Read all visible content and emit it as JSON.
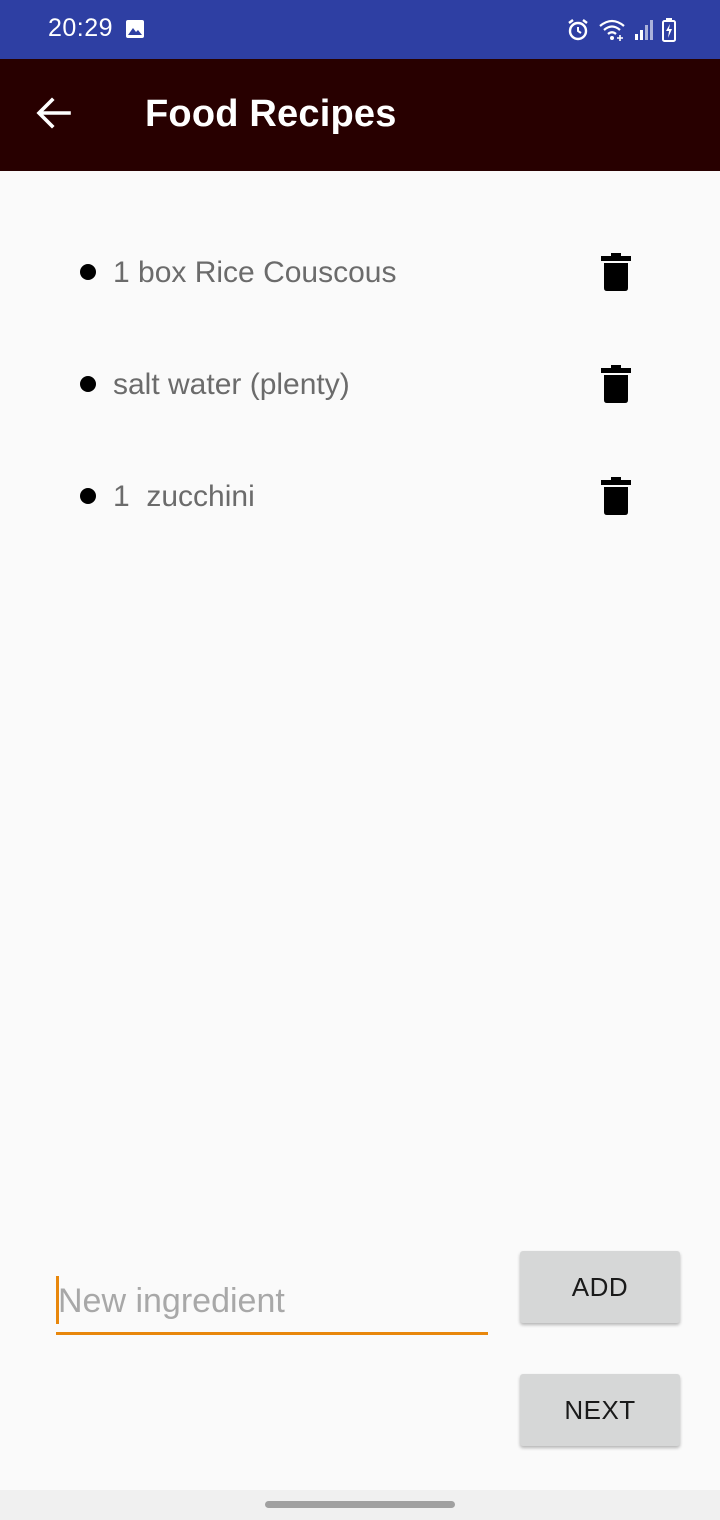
{
  "status_bar": {
    "time": "20:29",
    "icons": [
      "image-icon",
      "alarm-icon",
      "wifi-icon",
      "signal-icon",
      "battery-charging-icon"
    ]
  },
  "app_bar": {
    "back_icon": "arrow-back-icon",
    "title": "Food Recipes"
  },
  "ingredients": [
    {
      "text": "1 box Rice Couscous",
      "delete_icon": "trash-icon"
    },
    {
      "text": "salt water (plenty)",
      "delete_icon": "trash-icon"
    },
    {
      "text": "1  zucchini",
      "delete_icon": "trash-icon"
    }
  ],
  "input": {
    "value": "",
    "placeholder": "New ingredient"
  },
  "buttons": {
    "add_label": "ADD",
    "next_label": "NEXT"
  },
  "colors": {
    "status_bar": "#2e3fa3",
    "app_bar": "#280000",
    "accent": "#e8870c",
    "button_bg": "#d6d7d7",
    "background": "#fafafa"
  }
}
